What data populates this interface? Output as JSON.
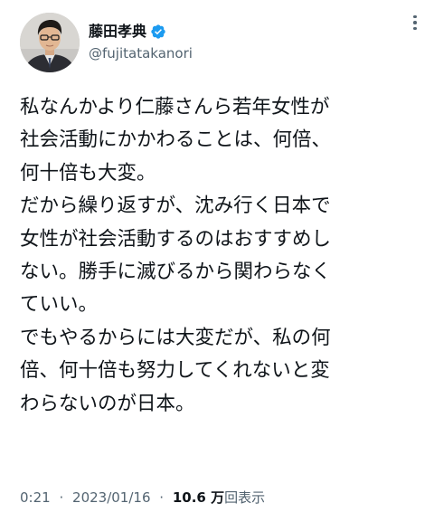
{
  "author": {
    "display_name": "藤田孝典",
    "handle": "@fujitatakanori",
    "avatar_icon": "avatar-photo",
    "verified_icon": "verified-badge-icon",
    "verified_color": "#1d9bf0"
  },
  "tweet": {
    "lines": [
      "私なんかより仁藤さんら若年女性が",
      "社会活動にかかわることは、何倍、",
      "何十倍も大変。",
      "だから繰り返すが、沈み行く日本で",
      "女性が社会活動するのはおすすめし",
      "ない。勝手に滅びるから関わらなく",
      "ていい。",
      "でもやるからには大変だが、私の何",
      "倍、何十倍も努力してくれないと変",
      "わらないのが日本。"
    ]
  },
  "meta": {
    "time": "0:21",
    "separator": "·",
    "date": "2023/01/16",
    "views_count": "10.6 万",
    "views_label": "回表示"
  },
  "colors": {
    "text": "#0f1419",
    "secondary": "#536471",
    "background": "#ffffff"
  }
}
